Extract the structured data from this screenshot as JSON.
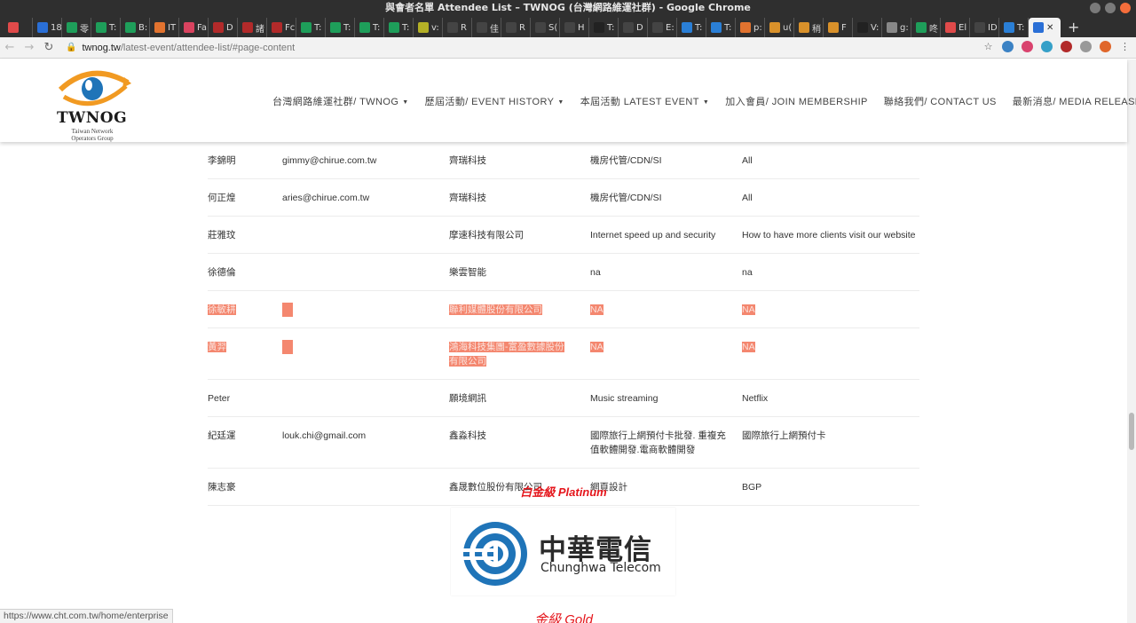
{
  "window": {
    "title": "與會者名單 Attendee List – TWNOG (台灣網路維運社群) - Google Chrome"
  },
  "tabs": [
    {
      "label": "",
      "color": "#e04a4a"
    },
    {
      "label": "18",
      "color": "#2a6fd6"
    },
    {
      "label": "零",
      "color": "#1e9e5a"
    },
    {
      "label": "T:",
      "color": "#1e9e5a"
    },
    {
      "label": "B:",
      "color": "#1e9e5a"
    },
    {
      "label": "IT",
      "color": "#e2732f"
    },
    {
      "label": "Fa",
      "color": "#d9435f"
    },
    {
      "label": "D",
      "color": "#b22a2a"
    },
    {
      "label": "諸",
      "color": "#b22a2a"
    },
    {
      "label": "Fc",
      "color": "#b22a2a"
    },
    {
      "label": "T:",
      "color": "#1e9e5a"
    },
    {
      "label": "T:",
      "color": "#1e9e5a"
    },
    {
      "label": "T:",
      "color": "#1e9e5a"
    },
    {
      "label": "T:",
      "color": "#1e9e5a"
    },
    {
      "label": "v:",
      "color": "#b4b026"
    },
    {
      "label": "R",
      "color": "#444444"
    },
    {
      "label": "佳",
      "color": "#444444"
    },
    {
      "label": "R",
      "color": "#444444"
    },
    {
      "label": "S(",
      "color": "#444444"
    },
    {
      "label": "H",
      "color": "#444444"
    },
    {
      "label": "T:",
      "color": "#222222"
    },
    {
      "label": "D",
      "color": "#444444"
    },
    {
      "label": "E:",
      "color": "#444444"
    },
    {
      "label": "T:",
      "color": "#2a7fd6"
    },
    {
      "label": "T:",
      "color": "#2a7fd6"
    },
    {
      "label": "p:",
      "color": "#e2732f"
    },
    {
      "label": "u(",
      "color": "#d9912a"
    },
    {
      "label": "稍",
      "color": "#d9912a"
    },
    {
      "label": "F",
      "color": "#d9912a"
    },
    {
      "label": "V:",
      "color": "#222222"
    },
    {
      "label": "g:",
      "color": "#888888"
    },
    {
      "label": "咚",
      "color": "#1e9e5a"
    },
    {
      "label": "El",
      "color": "#e04a4a"
    },
    {
      "label": "ID",
      "color": "#444444"
    },
    {
      "label": "T:",
      "color": "#2a7fd6"
    }
  ],
  "active_tab": {
    "label": "✕"
  },
  "address_bar": {
    "host": "twnog.tw",
    "path": "/latest-event/attendee-list/#page-content"
  },
  "site": {
    "logo_text": "TWNOG",
    "logo_sub": "Taiwan Network Operators Group",
    "nav": [
      {
        "label": "台灣網路維運社群/ TWNOG",
        "dropdown": true
      },
      {
        "label": "歷屆活動/ EVENT HISTORY",
        "dropdown": true
      },
      {
        "label": "本屆活動 LATEST EVENT",
        "dropdown": true
      },
      {
        "label": "加入會員/ JOIN MEMBERSHIP",
        "dropdown": false
      },
      {
        "label": "聯絡我們/ CONTACT US",
        "dropdown": false
      },
      {
        "label": "最新消息/ MEDIA RELEASES",
        "dropdown": true
      }
    ]
  },
  "attendees": [
    {
      "name": "李錦明",
      "email": "gimmy@chirue.com.tw",
      "company": "齊瑞科技",
      "business": "機房代管/CDN/SI",
      "interest": "All",
      "highlight": false
    },
    {
      "name": "何正煌",
      "email": "aries@chirue.com.tw",
      "company": "齊瑞科技",
      "business": "機房代管/CDN/SI",
      "interest": "All",
      "highlight": false
    },
    {
      "name": "莊雅玟",
      "email": "",
      "company": "摩速科技有限公司",
      "business": "Internet speed up and security",
      "interest": "How to have more clients visit our website",
      "highlight": false
    },
    {
      "name": "徐德倫",
      "email": "",
      "company": "樂雲智能",
      "business": "na",
      "interest": "na",
      "highlight": false
    },
    {
      "name": "徐敏耕",
      "email": "",
      "company": "聯利媒體股份有限公司",
      "business": "NA",
      "interest": "NA",
      "highlight": true
    },
    {
      "name": "黃羿",
      "email": "",
      "company": "鴻海科技集團-富盈數據股份有限公司",
      "business": "NA",
      "interest": "NA",
      "highlight": true
    },
    {
      "name": "Peter",
      "email": "",
      "company": "願境網訊",
      "business": "Music streaming",
      "interest": "Netflix",
      "highlight": false
    },
    {
      "name": "紀廷運",
      "email": "louk.chi@gmail.com",
      "company": "鑫淼科技",
      "business": "國際旅行上網預付卡批發. 重複充值軟體開發.電商軟體開發",
      "interest": "國際旅行上網預付卡",
      "highlight": false
    },
    {
      "name": "陳志豪",
      "email": "",
      "company": "鑫晟數位股份有限公司",
      "business": "網頁設計",
      "interest": "BGP",
      "highlight": false
    }
  ],
  "sponsors": {
    "platinum_title": "白金級 Platinum",
    "platinum_name_zh": "中華電信",
    "platinum_name_en": "Chunghwa Telecom",
    "gold_title": "金級 Gold"
  },
  "status_bar": "https://www.cht.com.tw/home/enterprise",
  "colors": {
    "highlight": "#f4876f",
    "tier_red": "#e5161c",
    "cht_blue": "#1f74b8"
  }
}
